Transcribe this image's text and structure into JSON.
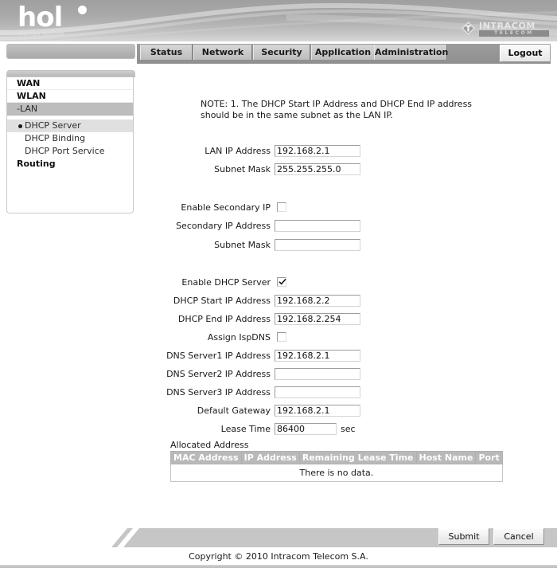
{
  "brand": {
    "logo_text": "hol",
    "logo_tagline": "hellas online",
    "vendor_name": "INTRACOM",
    "vendor_sub": "TELECOM"
  },
  "nav": {
    "tabs": [
      {
        "label": "Status"
      },
      {
        "label": "Network"
      },
      {
        "label": "Security"
      },
      {
        "label": "Application"
      },
      {
        "label": "Administration"
      }
    ],
    "logout_label": "Logout"
  },
  "sidebar": {
    "items": [
      {
        "label": "WAN",
        "type": "top"
      },
      {
        "label": "WLAN",
        "type": "top"
      },
      {
        "label": "-LAN",
        "type": "group"
      },
      {
        "label": "DHCP Server",
        "type": "sub",
        "active": true
      },
      {
        "label": "DHCP Binding",
        "type": "sub",
        "active": false
      },
      {
        "label": "DHCP Port Service",
        "type": "sub",
        "active": false
      },
      {
        "label": "Routing",
        "type": "top"
      }
    ]
  },
  "main": {
    "note": "NOTE:  1. The DHCP Start IP Address and DHCP End IP address should be in the same subnet as the LAN IP.",
    "fields": {
      "lan_ip_label": "LAN IP Address",
      "lan_ip_value": "192.168.2.1",
      "lan_mask_label": "Subnet Mask",
      "lan_mask_value": "255.255.255.0",
      "enable_secondary_label": "Enable Secondary IP",
      "enable_secondary_checked": false,
      "secondary_ip_label": "Secondary IP Address",
      "secondary_ip_value": "",
      "secondary_mask_label": "Subnet Mask",
      "secondary_mask_value": "",
      "enable_dhcp_label": "Enable DHCP Server",
      "enable_dhcp_checked": true,
      "dhcp_start_label": "DHCP Start IP Address",
      "dhcp_start_value": "192.168.2.2",
      "dhcp_end_label": "DHCP End IP Address",
      "dhcp_end_value": "192.168.2.254",
      "assign_ispdns_label": "Assign IspDNS",
      "assign_ispdns_checked": false,
      "dns1_label": "DNS Server1 IP Address",
      "dns1_value": "192.168.2.1",
      "dns2_label": "DNS Server2 IP Address",
      "dns2_value": "",
      "dns3_label": "DNS Server3 IP Address",
      "dns3_value": "",
      "gateway_label": "Default Gateway",
      "gateway_value": "192.168.2.1",
      "lease_label": "Lease Time",
      "lease_value": "86400",
      "lease_unit": "sec"
    },
    "allocated": {
      "title": "Allocated Address",
      "columns": [
        "MAC Address",
        "IP Address",
        "Remaining Lease Time",
        "Host Name",
        "Port"
      ],
      "empty_message": "There is no data.",
      "rows": []
    }
  },
  "footer": {
    "submit_label": "Submit",
    "cancel_label": "Cancel",
    "copyright": "Copyright © 2010 Intracom Telecom S.A."
  },
  "colors": {
    "banner_dark": "#9f9f9f",
    "banner_light": "#d8d8d8",
    "nav_strip": "#9c9c9c",
    "tab_face": "#d6d6d6",
    "group_highlight": "#bdbdbd",
    "table_header": "#b9b9b9",
    "accent_text": "#1a1a1a"
  }
}
